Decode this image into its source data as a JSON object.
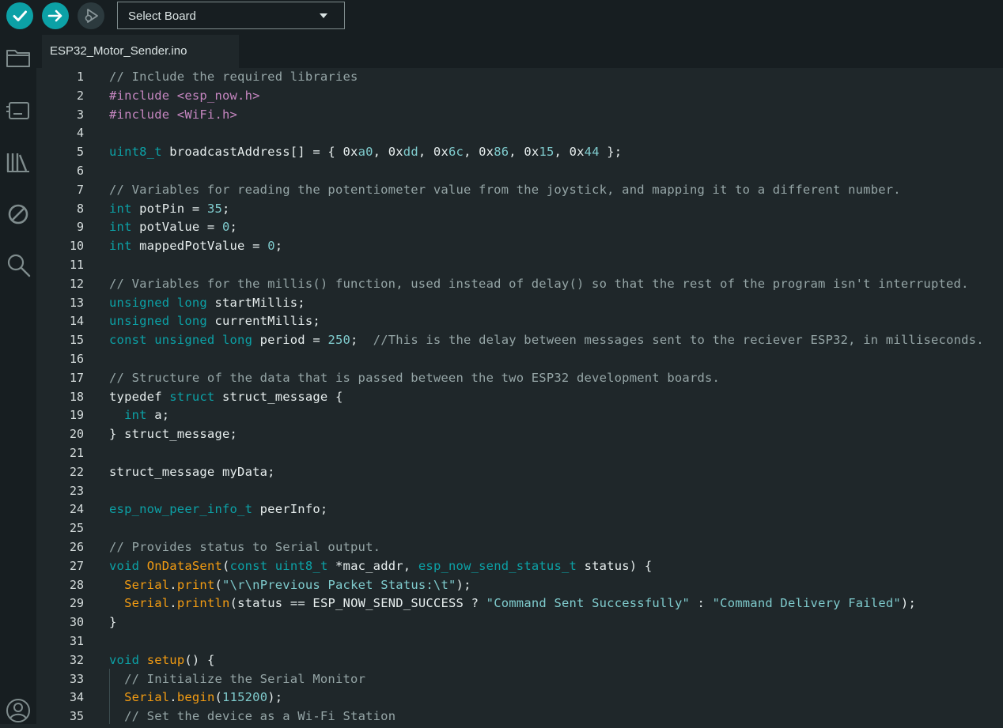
{
  "toolbar": {
    "board_select_label": "Select Board"
  },
  "tabs": [
    {
      "label": "ESP32_Motor_Sender.ino"
    }
  ],
  "sidebar": {
    "items": [
      "folder-icon",
      "board-icon",
      "library-icon",
      "debug-off-icon",
      "search-icon",
      "account-icon"
    ]
  },
  "editor": {
    "lines": [
      [
        [
          "com",
          "// Include the required libraries"
        ]
      ],
      [
        [
          "dir",
          "#include <esp_now.h>"
        ]
      ],
      [
        [
          "dir",
          "#include <WiFi.h>"
        ]
      ],
      [],
      [
        [
          "typ",
          "uint8_t"
        ],
        [
          "ident",
          " broadcastAddress[] = { 0x"
        ],
        [
          "num",
          "a0"
        ],
        [
          "ident",
          ", 0x"
        ],
        [
          "num",
          "dd"
        ],
        [
          "ident",
          ", 0x"
        ],
        [
          "num",
          "6c"
        ],
        [
          "ident",
          ", 0x"
        ],
        [
          "num",
          "86"
        ],
        [
          "ident",
          ", 0x"
        ],
        [
          "num",
          "15"
        ],
        [
          "ident",
          ", 0x"
        ],
        [
          "num",
          "44"
        ],
        [
          "ident",
          " };"
        ]
      ],
      [],
      [
        [
          "com",
          "// Variables for reading the potentiometer value from the joystick, and mapping it to a different number."
        ]
      ],
      [
        [
          "typ",
          "int"
        ],
        [
          "ident",
          " potPin = "
        ],
        [
          "num",
          "35"
        ],
        [
          "ident",
          ";"
        ]
      ],
      [
        [
          "typ",
          "int"
        ],
        [
          "ident",
          " potValue = "
        ],
        [
          "num",
          "0"
        ],
        [
          "ident",
          ";"
        ]
      ],
      [
        [
          "typ",
          "int"
        ],
        [
          "ident",
          " mappedPotValue = "
        ],
        [
          "num",
          "0"
        ],
        [
          "ident",
          ";"
        ]
      ],
      [],
      [
        [
          "com",
          "// Variables for the millis() function, used instead of delay() so that the rest of the program isn't interrupted."
        ]
      ],
      [
        [
          "typ",
          "unsigned long"
        ],
        [
          "ident",
          " startMillis;"
        ]
      ],
      [
        [
          "typ",
          "unsigned long"
        ],
        [
          "ident",
          " currentMillis;"
        ]
      ],
      [
        [
          "typ",
          "const unsigned long"
        ],
        [
          "ident",
          " period = "
        ],
        [
          "num",
          "250"
        ],
        [
          "ident",
          ";  "
        ],
        [
          "com",
          "//This is the delay between messages sent to the reciever ESP32, in milliseconds."
        ]
      ],
      [],
      [
        [
          "com",
          "// Structure of the data that is passed between the two ESP32 development boards."
        ]
      ],
      [
        [
          "ident",
          "typedef "
        ],
        [
          "kw",
          "struct"
        ],
        [
          "ident",
          " struct_message {"
        ]
      ],
      [
        [
          "ident",
          "  "
        ],
        [
          "typ",
          "int"
        ],
        [
          "ident",
          " a;"
        ]
      ],
      [
        [
          "ident",
          "} struct_message;"
        ]
      ],
      [],
      [
        [
          "ident",
          "struct_message myData;"
        ]
      ],
      [],
      [
        [
          "typ",
          "esp_now_peer_info_t"
        ],
        [
          "ident",
          " peerInfo;"
        ]
      ],
      [],
      [
        [
          "com",
          "// Provides status to Serial output."
        ]
      ],
      [
        [
          "typ",
          "void"
        ],
        [
          "ident",
          " "
        ],
        [
          "fn",
          "OnDataSent"
        ],
        [
          "ident",
          "("
        ],
        [
          "typ",
          "const uint8_t"
        ],
        [
          "ident",
          " *mac_addr, "
        ],
        [
          "typ",
          "esp_now_send_status_t"
        ],
        [
          "ident",
          " status) {"
        ]
      ],
      [
        [
          "ident",
          "  "
        ],
        [
          "fn",
          "Serial"
        ],
        [
          "ident",
          "."
        ],
        [
          "fn",
          "print"
        ],
        [
          "ident",
          "("
        ],
        [
          "str",
          "\"\\r\\nPrevious Packet Status:\\t\""
        ],
        [
          "ident",
          ");"
        ]
      ],
      [
        [
          "ident",
          "  "
        ],
        [
          "fn",
          "Serial"
        ],
        [
          "ident",
          "."
        ],
        [
          "fn",
          "println"
        ],
        [
          "ident",
          "(status == ESP_NOW_SEND_SUCCESS ? "
        ],
        [
          "str",
          "\"Command Sent Successfully\""
        ],
        [
          "ident",
          " : "
        ],
        [
          "str",
          "\"Command Delivery Failed\""
        ],
        [
          "ident",
          ");"
        ]
      ],
      [
        [
          "ident",
          "}"
        ]
      ],
      [],
      [
        [
          "typ",
          "void"
        ],
        [
          "ident",
          " "
        ],
        [
          "fn",
          "setup"
        ],
        [
          "ident",
          "() {"
        ]
      ],
      [
        [
          "ident",
          "  "
        ],
        [
          "com",
          "// Initialize the Serial Monitor"
        ]
      ],
      [
        [
          "ident",
          "  "
        ],
        [
          "fn",
          "Serial"
        ],
        [
          "ident",
          "."
        ],
        [
          "fn",
          "begin"
        ],
        [
          "ident",
          "("
        ],
        [
          "num",
          "115200"
        ],
        [
          "ident",
          ");"
        ]
      ],
      [
        [
          "ident",
          "  "
        ],
        [
          "com",
          "// Set the device as a Wi-Fi Station"
        ]
      ]
    ]
  }
}
